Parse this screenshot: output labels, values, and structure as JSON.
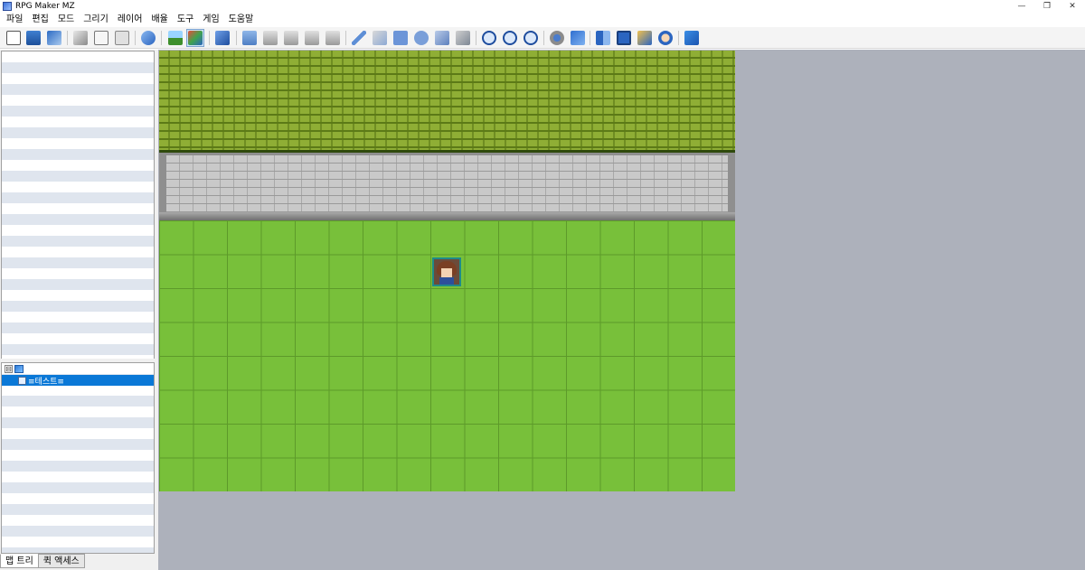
{
  "window": {
    "title": "RPG Maker MZ",
    "controls": [
      "—",
      "❐",
      "✕"
    ]
  },
  "menu": [
    "파일",
    "편집",
    "모드",
    "그리기",
    "레이어",
    "배율",
    "도구",
    "게임",
    "도움말"
  ],
  "toolbar": {
    "icons": [
      "new-project-icon",
      "open-project-icon",
      "save-project-icon",
      "cut-icon",
      "copy-icon",
      "paste-icon",
      "undo-icon",
      "map-mode-icon",
      "event-mode-icon",
      "region-icon",
      "layer-auto-icon",
      "layer-1-icon",
      "layer-2-icon",
      "layer-3-icon",
      "layer-4-icon",
      "pencil-icon",
      "eraser-icon",
      "rectangle-icon",
      "ellipse-icon",
      "fill-icon",
      "shadow-pen-icon",
      "zoom-in-icon",
      "zoom-out-icon",
      "zoom-actual-icon",
      "database-icon",
      "plugin-manager-icon",
      "sound-test-icon",
      "event-searcher-icon",
      "resource-manager-icon",
      "character-generator-icon",
      "playtest-icon"
    ]
  },
  "map_tree": {
    "root_expander": "⊟",
    "selected_map": "≡테스트≡"
  },
  "tabs": [
    "맵 트리",
    "퀵 액세스"
  ],
  "colors": {
    "selection": "#0a78d7",
    "map_background": "#adb1bb",
    "grass": "#78c03a"
  }
}
